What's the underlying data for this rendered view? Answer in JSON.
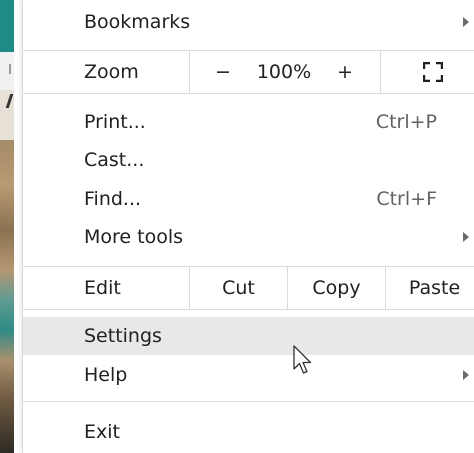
{
  "menu": {
    "bookmarks": {
      "label": "Bookmarks"
    },
    "zoom": {
      "label": "Zoom",
      "minus": "−",
      "value": "100%",
      "plus": "+"
    },
    "print": {
      "label": "Print...",
      "shortcut": "Ctrl+P"
    },
    "cast": {
      "label": "Cast..."
    },
    "find": {
      "label": "Find...",
      "shortcut": "Ctrl+F"
    },
    "more_tools": {
      "label": "More tools"
    },
    "edit": {
      "label": "Edit",
      "cut": "Cut",
      "copy": "Copy",
      "paste": "Paste"
    },
    "settings": {
      "label": "Settings"
    },
    "help": {
      "label": "Help"
    },
    "exit": {
      "label": "Exit"
    }
  },
  "icons": {
    "submenu": "chevron-right-icon",
    "fullscreen": "fullscreen-icon",
    "cursor": "mouse-pointer-icon"
  },
  "colors": {
    "hover_background": "#e8e8e8",
    "separator": "#dadce0",
    "shortcut_text": "#5f6368"
  }
}
